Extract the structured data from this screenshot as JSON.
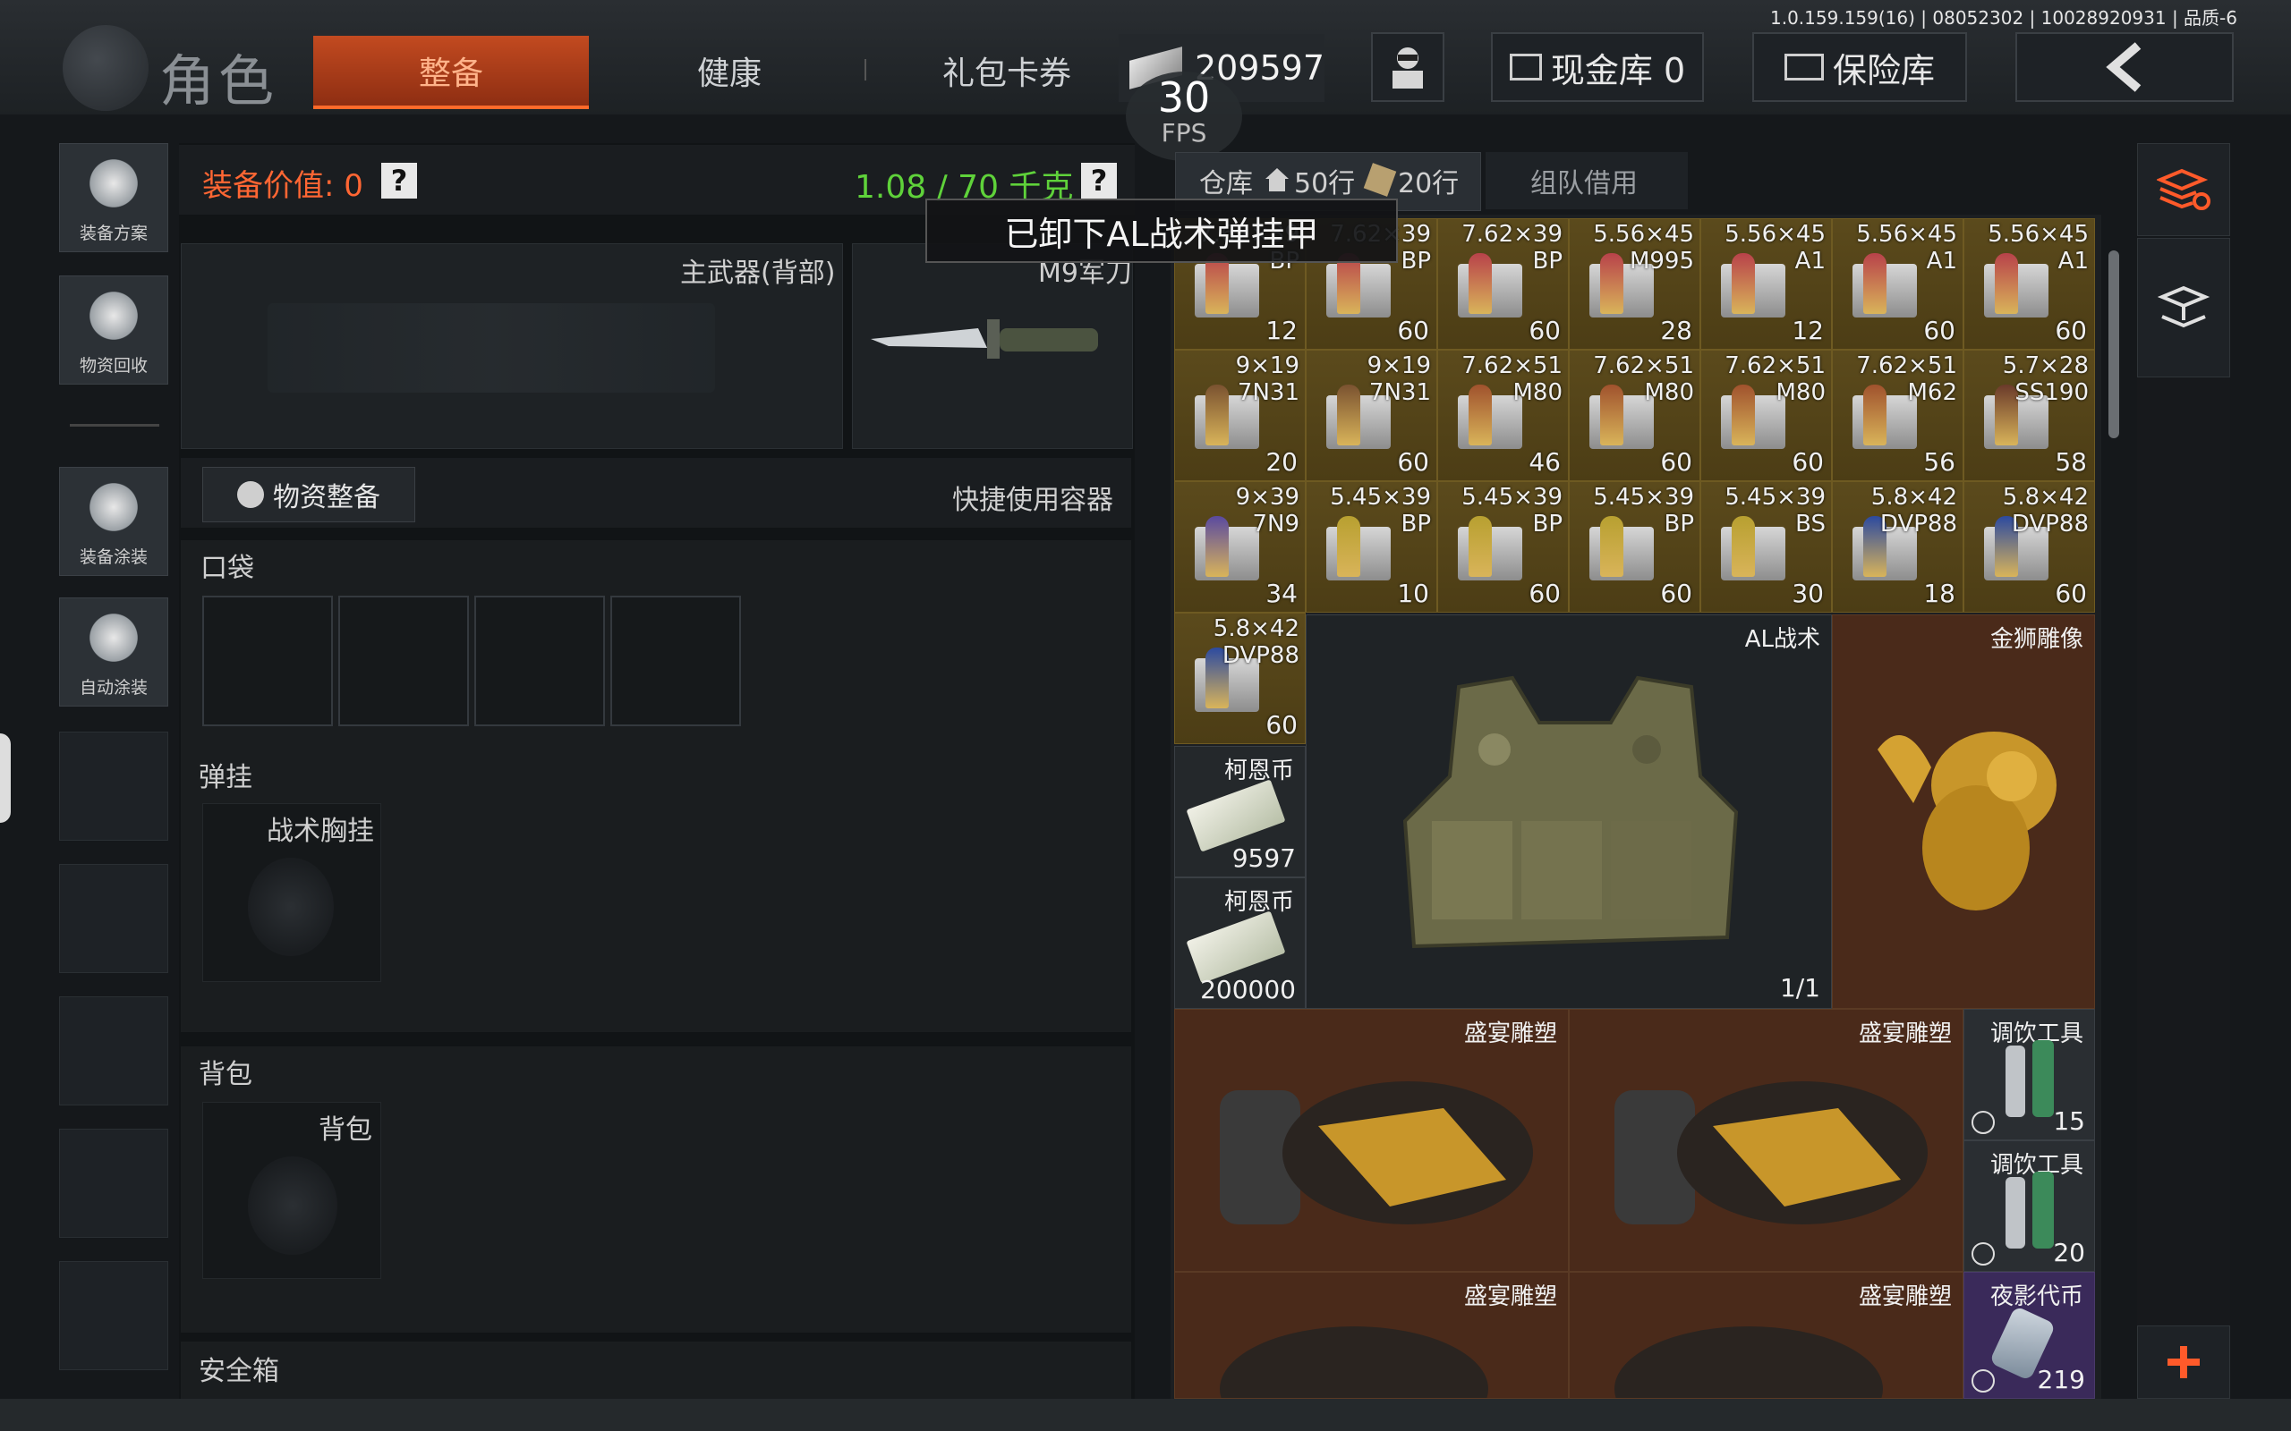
{
  "version": "1.0.159.159(16) | 08052302 | 10028920931 | 品质-6",
  "title": "角色",
  "tabs": [
    "整备",
    "健康",
    "礼包卡券"
  ],
  "currency": {
    "amount": "209597"
  },
  "buttons": {
    "cash": "现金库 0",
    "insurance": "保险库"
  },
  "fps": {
    "value": "30",
    "label": "FPS"
  },
  "sidebar": {
    "loadout": "装备方案",
    "recycle": "物资回收",
    "skin": "装备涂装",
    "autoskin": "自动涂装"
  },
  "equip": {
    "value_label": "装备价值: 0",
    "weight": "1.08 / 70 千克",
    "help": "?",
    "primary_weapon": "主武器(背部)",
    "melee": "M9军刀",
    "supply_prep": "物资整备",
    "quick_container": "快捷使用容器",
    "pockets": "口袋",
    "rig_section": "弹挂",
    "rig_slot": "战术胸挂",
    "backpack_section": "背包",
    "backpack_slot": "背包",
    "safebox": "安全箱"
  },
  "warehouse": {
    "tab_label": "仓库",
    "rows_home": "50行",
    "rows_extra": "20行",
    "team_borrow": "组队借用"
  },
  "toast": "已卸下AL战术弹挂甲",
  "ammo": [
    {
      "cal": "7.62×39",
      "type": "BP",
      "count": "12",
      "color": "#b8424a"
    },
    {
      "cal": "7.62×39",
      "type": "BP",
      "count": "60",
      "color": "#b8424a"
    },
    {
      "cal": "7.62×39",
      "type": "BP",
      "count": "60",
      "color": "#b8424a"
    },
    {
      "cal": "5.56×45",
      "type": "M995",
      "count": "28",
      "color": "#b8424a"
    },
    {
      "cal": "5.56×45",
      "type": "A1",
      "count": "12",
      "color": "#b8424a"
    },
    {
      "cal": "5.56×45",
      "type": "A1",
      "count": "60",
      "color": "#b8424a"
    },
    {
      "cal": "5.56×45",
      "type": "A1",
      "count": "60",
      "color": "#b8424a"
    },
    {
      "cal": "9×19",
      "type": "7N31",
      "count": "20",
      "color": "#7a5230"
    },
    {
      "cal": "9×19",
      "type": "7N31",
      "count": "60",
      "color": "#7a5230"
    },
    {
      "cal": "7.62×51",
      "type": "M80",
      "count": "46",
      "color": "#a0522d"
    },
    {
      "cal": "7.62×51",
      "type": "M80",
      "count": "60",
      "color": "#a0522d"
    },
    {
      "cal": "7.62×51",
      "type": "M80",
      "count": "60",
      "color": "#a0522d"
    },
    {
      "cal": "7.62×51",
      "type": "M62",
      "count": "56",
      "color": "#a0522d"
    },
    {
      "cal": "5.7×28",
      "type": "SS190",
      "count": "58",
      "color": "#6a3a2a"
    },
    {
      "cal": "9×39",
      "type": "7N9",
      "count": "34",
      "color": "#5a4aa0"
    },
    {
      "cal": "5.45×39",
      "type": "BP",
      "count": "10",
      "color": "#b8a030"
    },
    {
      "cal": "5.45×39",
      "type": "BP",
      "count": "60",
      "color": "#b8a030"
    },
    {
      "cal": "5.45×39",
      "type": "BP",
      "count": "60",
      "color": "#b8a030"
    },
    {
      "cal": "5.45×39",
      "type": "BS",
      "count": "30",
      "color": "#b8a030"
    },
    {
      "cal": "5.8×42",
      "type": "DVP88",
      "count": "18",
      "color": "#2c4aa0"
    },
    {
      "cal": "5.8×42",
      "type": "DVP88",
      "count": "60",
      "color": "#2c4aa0"
    },
    {
      "cal": "5.8×42",
      "type": "DVP88",
      "count": "60",
      "color": "#2c4aa0"
    }
  ],
  "items": {
    "coin1": {
      "name": "柯恩币",
      "count": "9597"
    },
    "coin2": {
      "name": "柯恩币",
      "count": "200000"
    },
    "vest": {
      "name": "AL战术",
      "durability": "1/1"
    },
    "lion": {
      "name": "金狮雕像"
    },
    "feast1": {
      "name": "盛宴雕塑"
    },
    "feast2": {
      "name": "盛宴雕塑"
    },
    "feast3": {
      "name": "盛宴雕塑"
    },
    "feast4": {
      "name": "盛宴雕塑"
    },
    "tool1": {
      "name": "调饮工具",
      "count": "15"
    },
    "tool2": {
      "name": "调饮工具",
      "count": "20"
    },
    "token": {
      "name": "夜影代币",
      "count": "219"
    }
  },
  "colors": {
    "accent": "#ff6a2a",
    "weight_green": "#5fd23a",
    "value_orange": "#ff6633"
  }
}
